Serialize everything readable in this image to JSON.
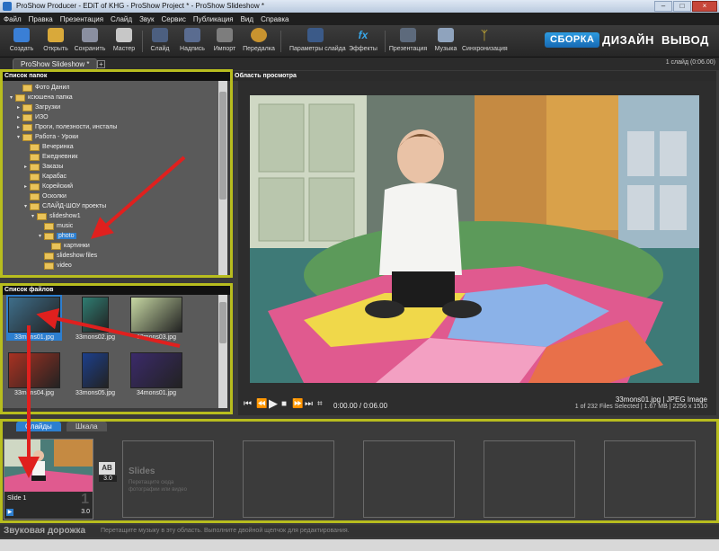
{
  "window": {
    "title": "ProShow Producer - EDiT of KHG - ProShow Project * - ProShow Slideshow *"
  },
  "menu": [
    "Файл",
    "Правка",
    "Презентация",
    "Слайд",
    "Звук",
    "Сервис",
    "Публикация",
    "Вид",
    "Справка"
  ],
  "toolbar": {
    "buttons": [
      "Создать",
      "Открыть",
      "Сохранить",
      "Мастер",
      "Слайд",
      "Надпись",
      "Импорт",
      "Передалка",
      "Параметры слайда",
      "Эффекты",
      "Презентация",
      "Музыка",
      "Синхронизация"
    ],
    "modes": [
      "СБОРКА",
      "ДИЗАЙН",
      "ВЫВОД"
    ]
  },
  "tab": {
    "name": "ProShow Slideshow *",
    "slide_count": "1 слайд (0:06.00)"
  },
  "folders": {
    "header": "Список папок",
    "items": [
      {
        "label": "Фото Данил",
        "indent": 2,
        "arrow": ""
      },
      {
        "label": "ксюшена папка",
        "indent": 1,
        "arrow": "▾"
      },
      {
        "label": "Загрузки",
        "indent": 2,
        "arrow": "▸"
      },
      {
        "label": "ИЗО",
        "indent": 2,
        "arrow": "▸"
      },
      {
        "label": "Проги, полезности, инсталы",
        "indent": 2,
        "arrow": "▸"
      },
      {
        "label": "Работа - Уроки",
        "indent": 2,
        "arrow": "▾"
      },
      {
        "label": "Вечеринка",
        "indent": 3,
        "arrow": ""
      },
      {
        "label": "Ежедневник",
        "indent": 3,
        "arrow": ""
      },
      {
        "label": "Заказы",
        "indent": 3,
        "arrow": "▸"
      },
      {
        "label": "Карабас",
        "indent": 3,
        "arrow": ""
      },
      {
        "label": "Корейский",
        "indent": 3,
        "arrow": "▸"
      },
      {
        "label": "Осколки",
        "indent": 3,
        "arrow": ""
      },
      {
        "label": "СЛАЙД-ШОУ проекты",
        "indent": 3,
        "arrow": "▾"
      },
      {
        "label": "slideshow1",
        "indent": 4,
        "arrow": "▾"
      },
      {
        "label": "music",
        "indent": 5,
        "arrow": ""
      },
      {
        "label": "photo",
        "indent": 5,
        "arrow": "▾",
        "selected": true
      },
      {
        "label": "картинки",
        "indent": 6,
        "arrow": ""
      },
      {
        "label": "slideshow files",
        "indent": 5,
        "arrow": ""
      },
      {
        "label": "video",
        "indent": 5,
        "arrow": ""
      }
    ]
  },
  "files": {
    "header": "Список файлов",
    "items": [
      {
        "name": "33mons01.jpg",
        "selected": true,
        "color": "#3e6e8a"
      },
      {
        "name": "33mons02.jpg",
        "selected": false,
        "color": "#2f7d72"
      },
      {
        "name": "33mons03.jpg",
        "selected": false,
        "color": "#c7d8a3"
      },
      {
        "name": "33mons04.jpg",
        "selected": false,
        "color": "#a83222"
      },
      {
        "name": "33mons05.jpg",
        "selected": false,
        "color": "#1c3f8c"
      },
      {
        "name": "34mons01.jpg",
        "selected": false,
        "color": "#3b2a6a"
      }
    ]
  },
  "preview": {
    "header": "Область просмотра",
    "time": "0:00.00 / 0:06.00",
    "file_name": "33mons01.jpg",
    "file_type": "JPEG Image",
    "file_details": "1 of 232 Files Selected | 1.67 MB | 2256 x 1510"
  },
  "timeline": {
    "tabs": [
      "Слайды",
      "Шкала"
    ],
    "slide": {
      "label": "Slide 1",
      "number": "1",
      "duration": "3.0",
      "transition": "3.0",
      "transition_icon": "AB"
    },
    "placeholder_title": "Slides",
    "placeholder_hint": "Перетащите сюда фотографии или видео"
  },
  "audio": {
    "label": "Звуковая дорожка",
    "hint": "Перетащите музыку в эту область. Выполните двойной щелчок для редактирования."
  },
  "colors": {
    "highlight": "#b8bd1e",
    "accent": "#2d7fd0",
    "arrow": "#e0201e"
  }
}
